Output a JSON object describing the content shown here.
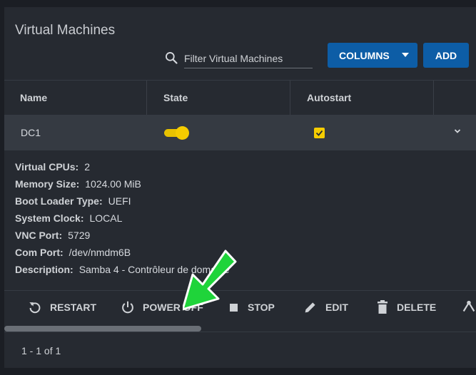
{
  "title": "Virtual Machines",
  "search": {
    "placeholder": "Filter Virtual Machines",
    "value": ""
  },
  "toolbar": {
    "columns_label": "COLUMNS",
    "add_label": "ADD"
  },
  "table": {
    "columns": [
      "Name",
      "State",
      "Autostart"
    ],
    "rows": [
      {
        "name": "DC1",
        "state_on": true,
        "autostart": true
      }
    ]
  },
  "details": [
    {
      "label": "Virtual CPUs:",
      "value": "2"
    },
    {
      "label": "Memory Size:",
      "value": "1024.00 MiB"
    },
    {
      "label": "Boot Loader Type:",
      "value": "UEFI"
    },
    {
      "label": "System Clock:",
      "value": "LOCAL"
    },
    {
      "label": "VNC Port:",
      "value": "5729"
    },
    {
      "label": "Com Port:",
      "value": "/dev/nmdm6B"
    },
    {
      "label": "Description:",
      "value": "Samba 4 - Contrôleur de domaine"
    }
  ],
  "actions": [
    {
      "label": "RESTART",
      "icon": "restart-icon"
    },
    {
      "label": "POWER OFF",
      "icon": "power-icon"
    },
    {
      "label": "STOP",
      "icon": "stop-icon"
    },
    {
      "label": "EDIT",
      "icon": "edit-icon"
    },
    {
      "label": "DELETE",
      "icon": "delete-icon"
    }
  ],
  "pagination": {
    "range": "1 - 1 of 1"
  },
  "colors": {
    "accent_blue": "#0d5da6",
    "toggle_yellow": "#f5cc00",
    "arrow_green": "#1fd43a"
  }
}
